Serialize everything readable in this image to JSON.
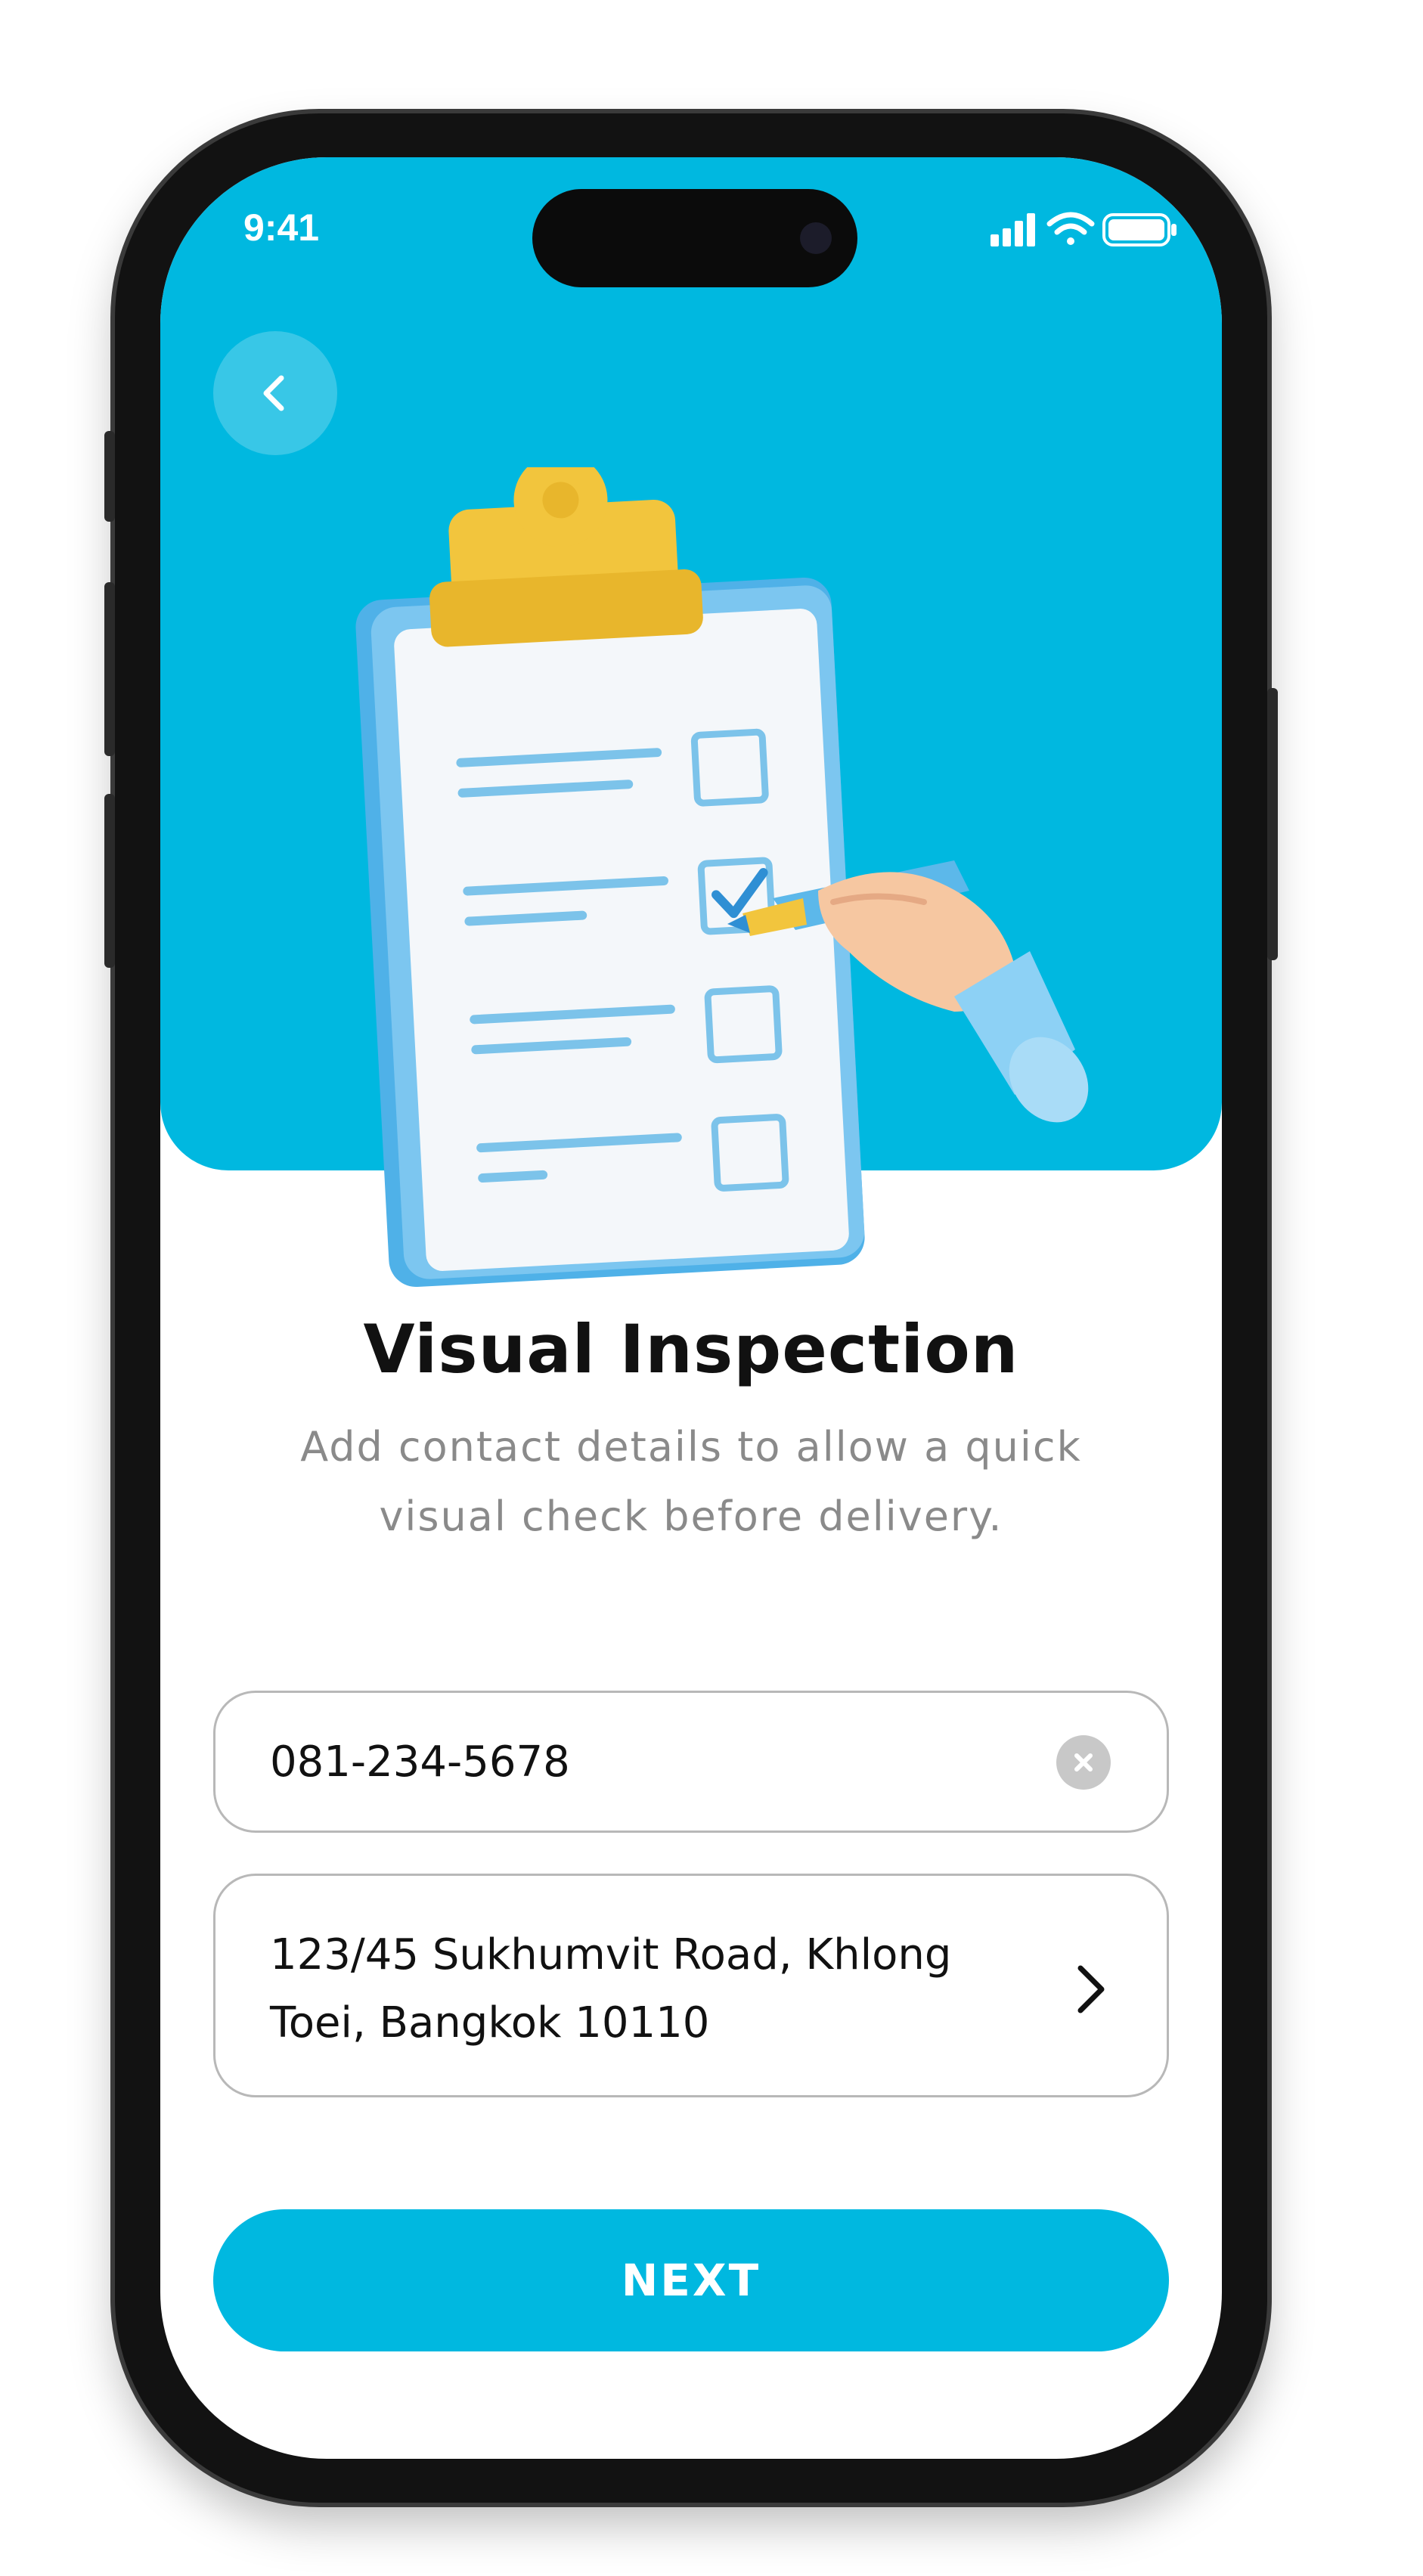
{
  "status_bar": {
    "time": "9:41"
  },
  "icons": {
    "back": "chevron-left-icon",
    "clear": "close-circle-icon",
    "address_arrow": "chevron-right-icon",
    "signal": "signal-icon",
    "wifi": "wifi-icon",
    "battery": "battery-icon"
  },
  "colors": {
    "accent": "#00b8e0",
    "text": "#111111",
    "muted": "#8a8a8a"
  },
  "page": {
    "title": "Visual Inspection",
    "subtitle": "Add contact details to allow a quick visual check before delivery."
  },
  "form": {
    "phone_value": "081-234-5678",
    "address_value": "123/45 Sukhumvit Road, Khlong Toei, Bangkok 10110"
  },
  "actions": {
    "next_label": "NEXT"
  }
}
